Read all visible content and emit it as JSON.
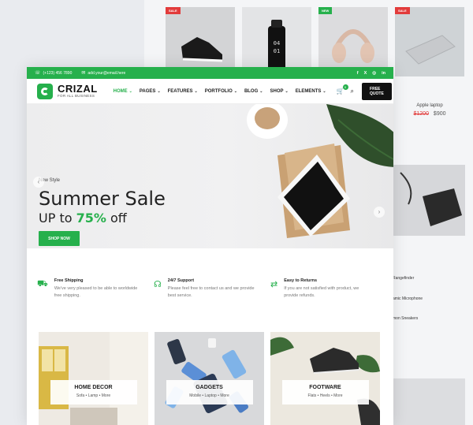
{
  "background": {
    "badges": [
      {
        "text": "SALE",
        "color": "#e23b3b"
      },
      {
        "text": "NEW",
        "color": "#26b04c"
      },
      {
        "text": "SALE",
        "color": "#e23b3b"
      }
    ],
    "product_name": "Apple laptop",
    "old_price": "$1200",
    "new_price": "$900",
    "list_items": [
      "Rangefinder",
      "amic Microphone",
      "mon Sneakers"
    ]
  },
  "topbar": {
    "phone": "(+123) 456 7890",
    "email": "add.your@email.here",
    "social": [
      "f",
      "X",
      "◎",
      "in"
    ]
  },
  "logo": {
    "name": "CRIZAL",
    "tagline": "FOR ALL BUSINESS"
  },
  "nav": {
    "items": [
      {
        "label": "HOME",
        "active": true
      },
      {
        "label": "PAGES"
      },
      {
        "label": "FEATURES"
      },
      {
        "label": "PORTFOLIO"
      },
      {
        "label": "BLOG"
      },
      {
        "label": "SHOP"
      },
      {
        "label": "ELEMENTS"
      }
    ],
    "cart_count": "0",
    "quote_label": "FREE QUOTE"
  },
  "hero": {
    "tag": "New Style",
    "title": "Summer Sale",
    "subtitle_prefix": "UP to ",
    "subtitle_pct": "75%",
    "subtitle_suffix": " off",
    "button": "SHOP NOW"
  },
  "features": [
    {
      "icon": "truck-icon",
      "title": "Free Shipping",
      "desc": "We've very pleased to be able to worldwide free shipping."
    },
    {
      "icon": "headset-icon",
      "title": "24/7 Support",
      "desc": "Please feel free to contact us and we provide best service."
    },
    {
      "icon": "returns-icon",
      "title": "Easy to Returns",
      "desc": "If you are not satisfied with product, we provide refunds."
    }
  ],
  "categories": [
    {
      "title": "HOME DECOR",
      "links": "Sofa  •  Lamp  •  More"
    },
    {
      "title": "GADGETS",
      "links": "Mobile  •  Laptop  •  More"
    },
    {
      "title": "FOOTWARE",
      "links": "Flats  •  Heels  •  More"
    }
  ],
  "colors": {
    "brand": "#26b04c",
    "sale": "#e23b3b",
    "dark": "#111111"
  }
}
